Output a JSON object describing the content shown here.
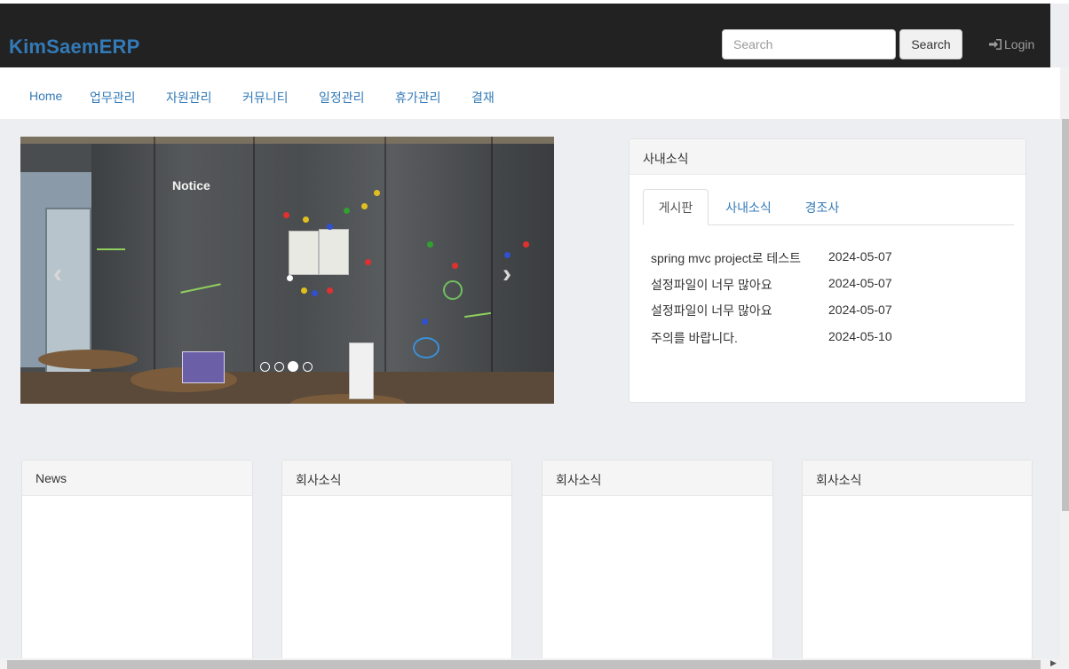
{
  "header": {
    "brand": "KimSaemERP",
    "search_placeholder": "Search",
    "search_button": "Search",
    "login_label": "Login",
    "brand_color": "#337ab7",
    "bar_color": "#222222"
  },
  "menu": {
    "items": [
      {
        "label": "Home"
      },
      {
        "label": "업무관리"
      },
      {
        "label": "자원관리"
      },
      {
        "label": "커뮤니티"
      },
      {
        "label": "일정관리"
      },
      {
        "label": "휴가관리"
      },
      {
        "label": "결재"
      }
    ]
  },
  "carousel": {
    "image_text": "Notice",
    "indicator_count": 4,
    "active_indicator": 3,
    "prev_icon": "chevron-left-icon",
    "next_icon": "chevron-right-icon"
  },
  "notice_panel": {
    "title": "사내소식",
    "tabs": [
      {
        "label": "게시판",
        "active": true
      },
      {
        "label": "사내소식",
        "active": false
      },
      {
        "label": "경조사",
        "active": false
      }
    ],
    "rows": [
      {
        "title": "spring mvc project로 테스트",
        "date": "2024-05-07"
      },
      {
        "title": "설정파일이 너무 많아요",
        "date": "2024-05-07"
      },
      {
        "title": "설정파일이 너무 많아요",
        "date": "2024-05-07"
      },
      {
        "title": "주의를 바랍니다.",
        "date": "2024-05-10"
      }
    ]
  },
  "bottom_panels": [
    {
      "title": "News"
    },
    {
      "title": "회사소식"
    },
    {
      "title": "회사소식"
    },
    {
      "title": "회사소식"
    }
  ]
}
